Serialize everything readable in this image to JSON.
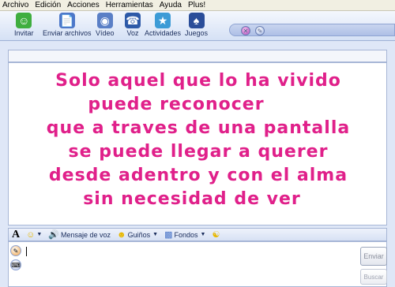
{
  "menu": [
    "Archivo",
    "Edición",
    "Acciones",
    "Herramientas",
    "Ayuda",
    "Plus!"
  ],
  "toolbar": [
    {
      "label": "Invitar",
      "icon": "invite-icon"
    },
    {
      "label": "Enviar archivos",
      "icon": "send-files-icon"
    },
    {
      "label": "Vídeo",
      "icon": "video-icon"
    },
    {
      "label": "Voz",
      "icon": "voice-icon"
    },
    {
      "label": "Actividades",
      "icon": "activities-icon"
    },
    {
      "label": "Juegos",
      "icon": "games-icon"
    }
  ],
  "message": {
    "lines": [
      "Solo aquel que lo ha vivido",
      "puede reconocer",
      "que a traves de una pantalla",
      "se puede llegar a querer",
      "desde adentro y con el alma",
      "sin necesidad de ver"
    ],
    "color": "#e0208a"
  },
  "input_toolbar": {
    "font_label": "A",
    "voice_clip": "Mensaje de voz",
    "winks": "Guiños",
    "backgrounds": "Fondos"
  },
  "buttons": {
    "send": "Enviar",
    "search": "Buscar"
  }
}
